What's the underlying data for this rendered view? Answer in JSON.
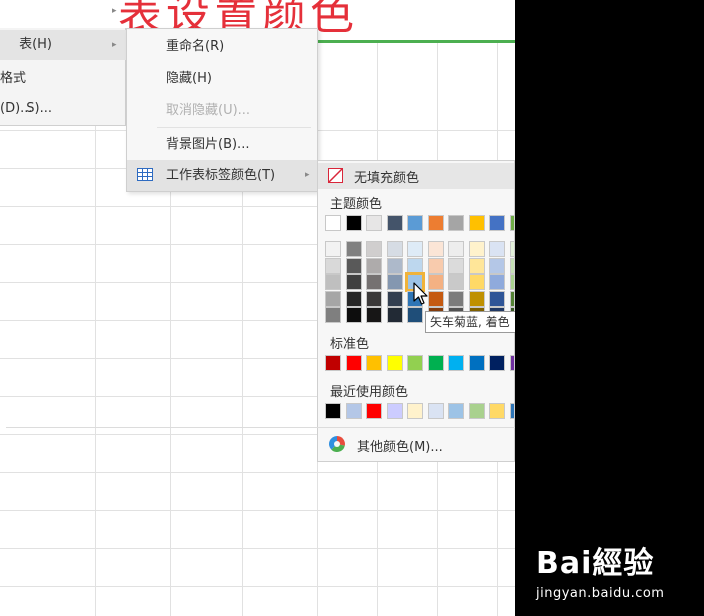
{
  "sheet": {
    "title_text": "表设置颜色"
  },
  "menu_left": {
    "items": [
      {
        "label": "表(H)"
      },
      {
        "label": "格式(D)..."
      },
      {
        "label": "S)..."
      }
    ]
  },
  "menu_mid": {
    "items": [
      {
        "label": "重命名(R)"
      },
      {
        "label": "隐藏(H)"
      },
      {
        "label": "取消隐藏(U)..."
      },
      {
        "label": "背景图片(B)..."
      },
      {
        "label": "工作表标签颜色(T)"
      }
    ]
  },
  "palette": {
    "no_fill": "无填充颜色",
    "theme_label": "主题颜色",
    "standard_label": "标准色",
    "recent_label": "最近使用颜色",
    "more_label": "其他颜色(M)...",
    "theme_top_row": [
      "#ffffff",
      "#000000",
      "#e7e6e6",
      "#44546a",
      "#5b9bd5",
      "#ed7d31",
      "#a5a5a5",
      "#ffc000",
      "#4472c4",
      "#70ad47"
    ],
    "theme_shades": [
      [
        "#f2f2f2",
        "#808080",
        "#d0cece",
        "#d6dce4",
        "#deebf7",
        "#fbe5d6",
        "#ededed",
        "#fff2cc",
        "#dae3f3",
        "#e2f0d9"
      ],
      [
        "#d9d9d9",
        "#595959",
        "#aeabab",
        "#adb9ca",
        "#bdd7ee",
        "#f8cbad",
        "#dbdbdb",
        "#ffe699",
        "#b4c7e7",
        "#c5e0b4"
      ],
      [
        "#bfbfbf",
        "#404040",
        "#757171",
        "#8497b0",
        "#9dc3e6",
        "#f4b183",
        "#c9c9c9",
        "#ffd966",
        "#8faadc",
        "#a9d18e"
      ],
      [
        "#a6a6a6",
        "#262626",
        "#3a3838",
        "#333f50",
        "#2e75b6",
        "#c55a11",
        "#7b7b7b",
        "#bf9000",
        "#2f5597",
        "#548235"
      ],
      [
        "#7f7f7f",
        "#0d0d0d",
        "#171616",
        "#222a35",
        "#1f4e79",
        "#843c0c",
        "#525252",
        "#7f6000",
        "#203864",
        "#385723"
      ]
    ],
    "standard_colors": [
      "#c00000",
      "#ff0000",
      "#ffc000",
      "#ffff00",
      "#92d050",
      "#00b050",
      "#00b0f0",
      "#0070c0",
      "#002060",
      "#7030a0"
    ],
    "recent_colors": [
      "#000000",
      "#b4c7e7",
      "#ff0000",
      "#ccccff",
      "#fff2cc",
      "#dae3f3",
      "#9dc3e6",
      "#a9d18e",
      "#ffd966",
      "#2e75b6"
    ],
    "selected_swatch": "theme shade row 3, column 5"
  },
  "tooltip": {
    "text": "矢车菊蓝, 着色"
  },
  "watermark": {
    "brand": "Bai經验",
    "url": "jingyan.baidu.com"
  }
}
